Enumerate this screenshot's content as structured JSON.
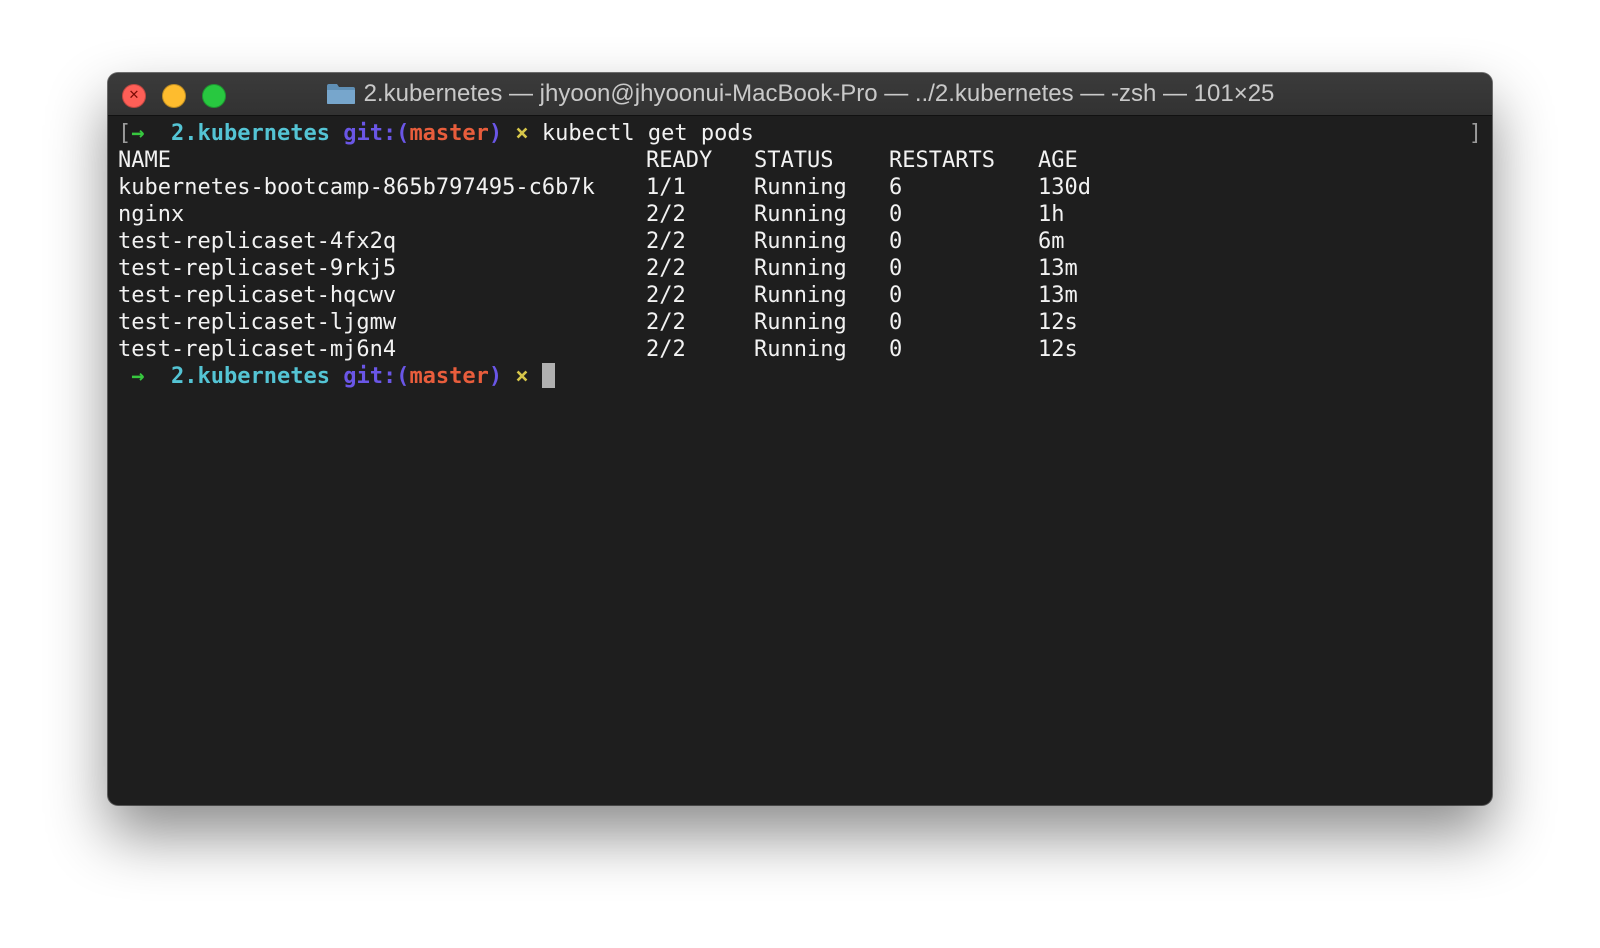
{
  "window": {
    "title": "2.kubernetes — jhyoon@jhyoonui-MacBook-Pro — ../2.kubernetes — -zsh — 101×25",
    "folder_icon": "folder-icon"
  },
  "colors": {
    "background": "#1e1e1e",
    "prompt_arrow": "#37c83f",
    "directory": "#54c4d4",
    "git": "#6a56e6",
    "branch": "#e85d3c",
    "dirty_mark": "#d6c64a"
  },
  "prompt1": {
    "open_bracket": "[",
    "arrow": "→",
    "dir": "2.kubernetes",
    "git_prefix": "git:(",
    "branch": "master",
    "git_suffix": ")",
    "mark": "×",
    "command": "kubectl get pods"
  },
  "right_bracket": "]",
  "table": {
    "headers": [
      "NAME",
      "READY",
      "STATUS",
      "RESTARTS",
      "AGE"
    ],
    "rows": [
      [
        "kubernetes-bootcamp-865b797495-c6b7k",
        "1/1",
        "Running",
        "6",
        "130d"
      ],
      [
        "nginx",
        "2/2",
        "Running",
        "0",
        "1h"
      ],
      [
        "test-replicaset-4fx2q",
        "2/2",
        "Running",
        "0",
        "6m"
      ],
      [
        "test-replicaset-9rkj5",
        "2/2",
        "Running",
        "0",
        "13m"
      ],
      [
        "test-replicaset-hqcwv",
        "2/2",
        "Running",
        "0",
        "13m"
      ],
      [
        "test-replicaset-ljgmw",
        "2/2",
        "Running",
        "0",
        "12s"
      ],
      [
        "test-replicaset-mj6n4",
        "2/2",
        "Running",
        "0",
        "12s"
      ]
    ]
  },
  "prompt2": {
    "arrow": "→",
    "dir": "2.kubernetes",
    "git_prefix": "git:(",
    "branch": "master",
    "git_suffix": ")",
    "mark": "×"
  }
}
